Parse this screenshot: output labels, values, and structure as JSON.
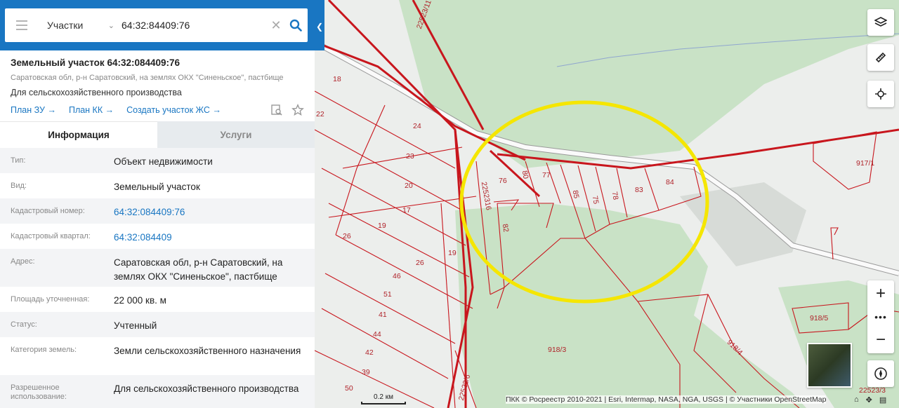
{
  "search": {
    "mode": "Участки",
    "query": "64:32:84409:76"
  },
  "parcel": {
    "title": "Земельный участок 64:32:084409:76",
    "address": "Саратовская обл, р-н Саратовский, на землях ОКХ \"Синеньское\", пастбище",
    "use": "Для сельскохозяйственного производства",
    "links": [
      "План ЗУ",
      "План КК",
      "Создать участок ЖС"
    ]
  },
  "tabs": [
    "Информация",
    "Услуги"
  ],
  "info": [
    {
      "key": "Тип:",
      "value": "Объект недвижимости"
    },
    {
      "key": "Вид:",
      "value": "Земельный участок"
    },
    {
      "key": "Кадастровый номер:",
      "value": "64:32:084409:76"
    },
    {
      "key": "Кадастровый квартал:",
      "value": "64:32:084409"
    },
    {
      "key": "Адрес:",
      "value": "Саратовская обл, р-н Саратовский, на землях ОКХ \"Синеньское\", пастбище"
    },
    {
      "key": "Площадь уточненная:",
      "value": "22 000 кв. м"
    },
    {
      "key": "Статус:",
      "value": "Учтенный"
    },
    {
      "key": "Категория земель:",
      "value": "Земли сельскохозяйственного назначения"
    },
    {
      "key": "Разрешенное использование:",
      "value": "Для сельскохозяйственного производства"
    }
  ],
  "map": {
    "scale_label": "0.2 км",
    "attribution": "ПКК © Росреестр 2010-2021 | Esri, Intermap, NASA, NGA, USGS | © Участники OpenStreetMap",
    "parcel_labels": [
      "18",
      "22",
      "24",
      "23",
      "20",
      "17",
      "19",
      "26",
      "19",
      "26",
      "46",
      "51",
      "41",
      "44",
      "42",
      "39",
      "50",
      "76",
      "80",
      "77",
      "85",
      "75",
      "78",
      "83",
      "84",
      "82",
      "2252316",
      "22523/11",
      "917/1",
      "918/5",
      "918/3",
      "918/4",
      "22523/6",
      "22523/3"
    ],
    "highlight_color": "#f5e600",
    "boundary_color": "#c8161d"
  }
}
